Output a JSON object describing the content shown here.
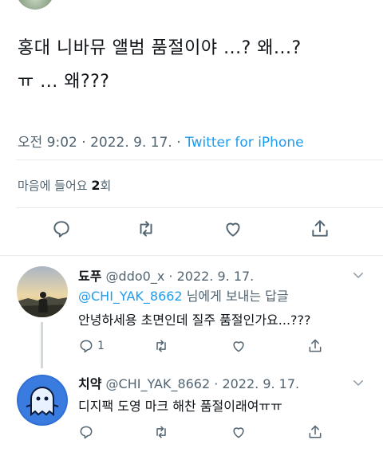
{
  "tweet": {
    "text_line1": "홍대 니바뮤 앨범 품절이야 ...? 왜...?",
    "text_line2": "ㅠ ... 왜???",
    "time": "오전 9:02",
    "sep1": "·",
    "date": "2022. 9. 17.",
    "sep2": "·",
    "source": "Twitter for iPhone",
    "likes_label": "마음에 들어요",
    "likes_count": "2",
    "likes_unit": "회"
  },
  "icons": {
    "reply": "reply-icon",
    "retweet": "retweet-icon",
    "like": "heart-icon",
    "share": "share-icon",
    "caret": "chevron-down-icon"
  },
  "colors": {
    "accent": "#1d9bf0",
    "secondary_text": "#536471",
    "divider": "#e6ecf0"
  },
  "replies": [
    {
      "name": "됴푸",
      "handle": "@ddo0_x",
      "sep": "·",
      "date": "2022. 9. 17.",
      "to_mention": "@CHI_YAK_8662",
      "to_suffix": " 님에게 보내는 답글",
      "text": "안녕하세용 초면인데 질주 품절인가요...???",
      "reply_count": "1"
    },
    {
      "name": "치약",
      "handle": "@CHI_YAK_8662",
      "sep": "·",
      "date": "2022. 9. 17.",
      "text": "디지팩 도영 마크 해찬 품절이래여ㅠㅠ",
      "reply_count": ""
    }
  ]
}
